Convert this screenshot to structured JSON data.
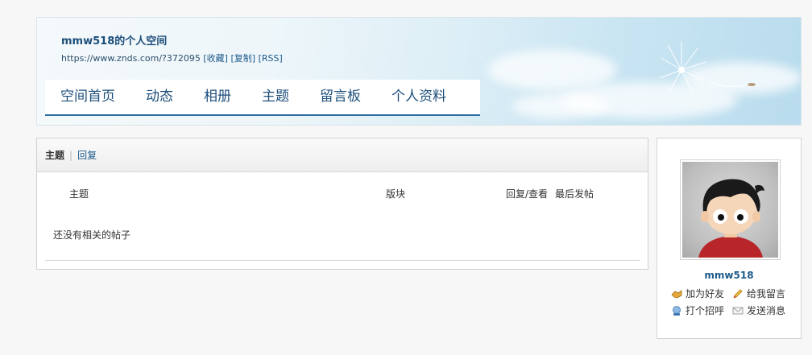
{
  "header": {
    "title": "mmw518的个人空间",
    "url": "https://www.znds.com/?372095",
    "links": [
      "[收藏]",
      "[复制]",
      "[RSS]"
    ]
  },
  "nav": {
    "items": [
      "空间首页",
      "动态",
      "相册",
      "主题",
      "留言板",
      "个人资料"
    ]
  },
  "threads": {
    "tab_active": "主题",
    "tab_separator": "|",
    "tab_other": "回复",
    "columns": {
      "subject": "主题",
      "forum": "版块",
      "replies_views": "回复/查看",
      "last_post": "最后发帖"
    },
    "empty_message": "还没有相关的帖子"
  },
  "profile": {
    "username": "mmw518",
    "actions": {
      "add_friend": "加为好友",
      "leave_message": "给我留言",
      "poke": "打个招呼",
      "send_pm": "发送消息"
    }
  },
  "icons": {
    "add_friend": "handshake-icon",
    "leave_message": "pencil-icon",
    "poke": "wave-icon",
    "send_pm": "envelope-icon"
  },
  "colors": {
    "link": "#1c5a8a",
    "nav_underline": "#2d6da0"
  }
}
